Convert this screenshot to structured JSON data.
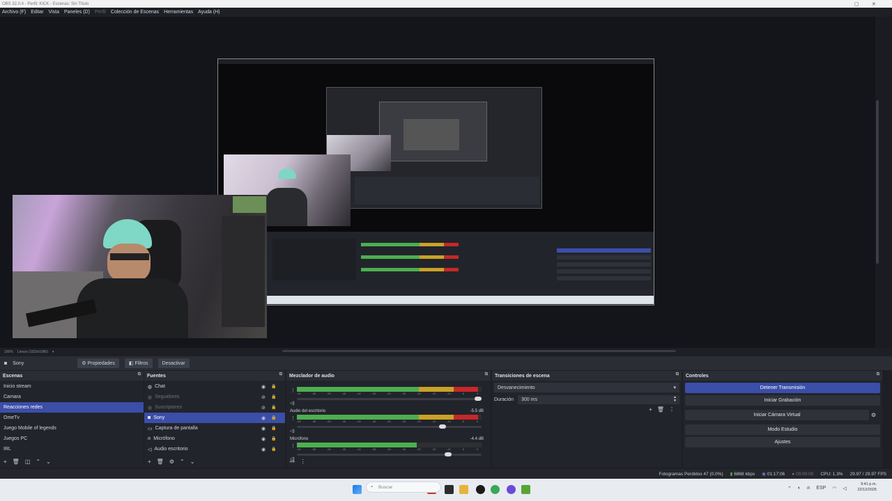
{
  "window": {
    "title": "OBS 32.0.4 - Perfil: KICK - Escenas: Sin Título"
  },
  "menu": {
    "items": [
      "Archivo (F)",
      "Editar",
      "Vista",
      "Paneles (D)",
      "Perfil",
      "Colección de Escenas",
      "Herramientas",
      "Ayuda (H)"
    ]
  },
  "preview": {
    "zoom": "100%",
    "canvas_label": "Lienzo (1920x1080)"
  },
  "source_bar": {
    "current_source": "Sony",
    "properties_label": "Propiedades",
    "filters_label": "Filtros",
    "deactivate_label": "Desactivar"
  },
  "scenes": {
    "title": "Escenas",
    "items": [
      "Inicio stream",
      "Camara",
      "Reacciones redes",
      "OmeTv",
      "Juego Mobile of legends",
      "Juegos PC",
      "IRL"
    ],
    "selected_index": 2
  },
  "sources": {
    "title": "Fuentes",
    "items": [
      {
        "name": "Chat",
        "icon": "globe-icon",
        "visible": true
      },
      {
        "name": "Seguidores",
        "icon": "globe-icon",
        "visible": false
      },
      {
        "name": "Suscriptores",
        "icon": "globe-icon",
        "visible": false
      },
      {
        "name": "Sony",
        "icon": "camera-icon",
        "visible": true
      },
      {
        "name": "Captura de pantalla",
        "icon": "monitor-icon",
        "visible": true
      },
      {
        "name": "Micrófono",
        "icon": "microphone-icon",
        "visible": true
      },
      {
        "name": "Audio escritorio",
        "icon": "speaker-icon",
        "visible": true
      }
    ],
    "selected_index": 3
  },
  "mixer": {
    "title": "Mezclador de audio",
    "ticks": [
      "-60",
      "-55",
      "-50",
      "-45",
      "-40",
      "-35",
      "-30",
      "-25",
      "-20",
      "-15",
      "-10",
      "-5",
      "0"
    ],
    "channels": [
      {
        "name": "",
        "db": "",
        "level": 0.98,
        "volume": 1.0
      },
      {
        "name": "Audio del escritorio",
        "db": "-5.5 dB",
        "level": 0.98,
        "volume": 0.8
      },
      {
        "name": "Micrófono",
        "db": "-4.4 dB",
        "level": 0.65,
        "volume": 0.83
      }
    ]
  },
  "transitions": {
    "title": "Transiciones de escena",
    "current": "Desvanecimiento",
    "duration_label": "Duración",
    "duration_value": "300 ms"
  },
  "controls": {
    "title": "Controles",
    "buttons": [
      "Detener Transmisión",
      "Iniciar Grabación",
      "Iniciar Cámara Virtual",
      "Modo Estudio",
      "Ajustes"
    ]
  },
  "status": {
    "dropped_frames": "Fotogramas Perdidos 47 (0.0%)",
    "bitrate": "6868 kbps",
    "stream_time": "01:17:06",
    "rec_time": "00:00:00",
    "cpu": "CPU: 1.3%",
    "fps": "29.97 / 29.97 FPS"
  },
  "taskbar": {
    "search_placeholder": "Buscar",
    "language": "ESP",
    "time": "9:41 p.m.",
    "date": "22/12/2025"
  },
  "colors": {
    "accent": "#3b4ea8",
    "panel": "#22242b",
    "background": "#1d1f24",
    "meter_green": "#4caf50",
    "meter_yellow": "#c9a227",
    "meter_red": "#c62828"
  }
}
